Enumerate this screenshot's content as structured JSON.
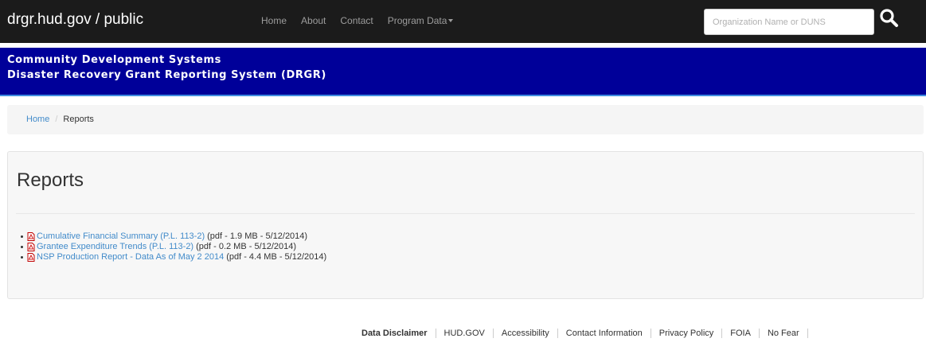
{
  "navbar": {
    "brand": "drgr.hud.gov / public",
    "links": [
      "Home",
      "About",
      "Contact",
      "Program Data"
    ],
    "search_placeholder": "Organization Name or DUNS",
    "search_icon": "search-icon"
  },
  "banner": {
    "line1": "Community Development Systems",
    "line2": "Disaster Recovery Grant Reporting System (DRGR)",
    "background": "#000099"
  },
  "breadcrumb": {
    "home": "Home",
    "separator": "/",
    "current": "Reports"
  },
  "main": {
    "title": "Reports",
    "reports": [
      {
        "icon": "pdf-icon",
        "link": "Cumulative Financial Summary (P.L. 113-2)",
        "meta": "(pdf - 1.9 MB - 5/12/2014)"
      },
      {
        "icon": "pdf-icon",
        "link": "Grantee Expenditure Trends (P.L. 113-2)",
        "meta": "(pdf - 0.2 MB - 5/12/2014)"
      },
      {
        "icon": "pdf-icon",
        "link": "NSP Production Report - Data As of May 2 2014",
        "meta": "(pdf - 4.4 MB - 5/12/2014)"
      }
    ]
  },
  "footer": {
    "links": [
      "Data Disclaimer",
      "HUD.GOV",
      "Accessibility",
      "Contact Information",
      "Privacy Policy",
      "FOIA",
      "No Fear"
    ]
  },
  "colors": {
    "navbar": "#1b1b1b",
    "link": "#428bca",
    "banner_border": "#3f8ce0"
  }
}
